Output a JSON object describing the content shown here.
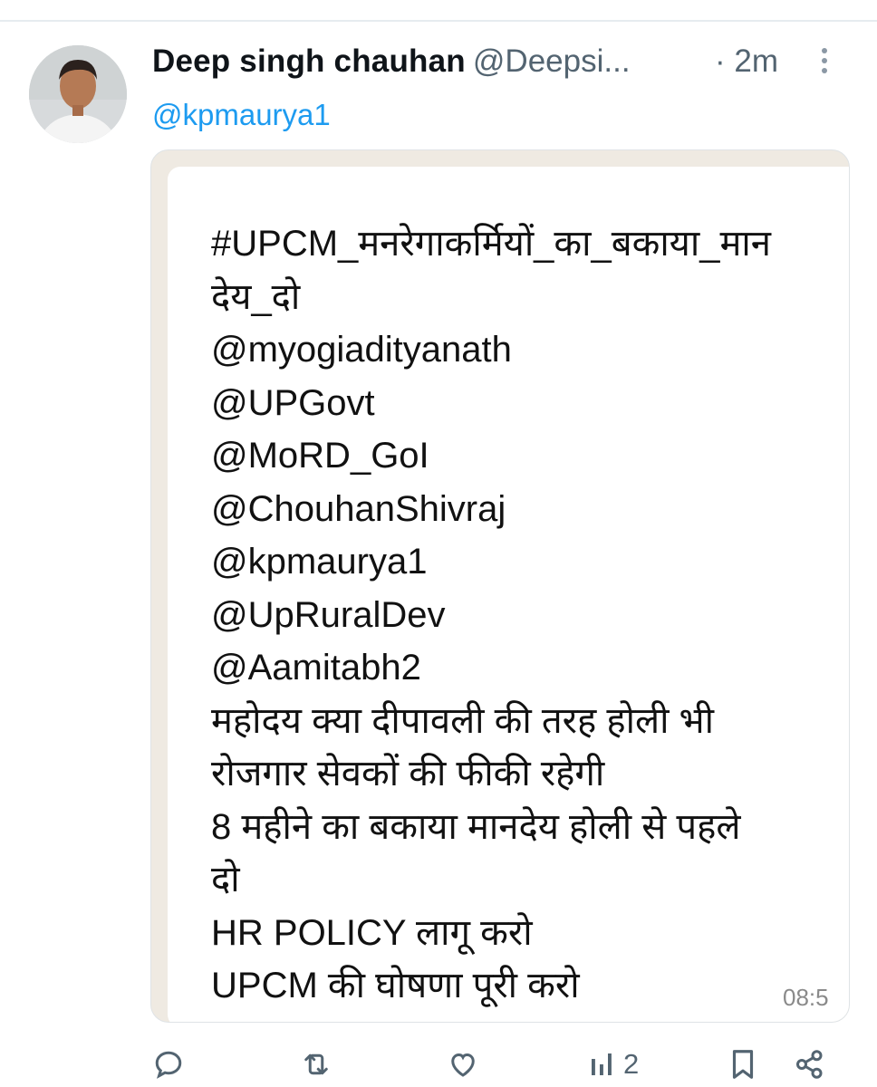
{
  "tweet": {
    "display_name": "Deep singh chauhan",
    "handle": "@Deepsi...",
    "time": "· 2m",
    "reply_to": "@kpmaurya1"
  },
  "media": {
    "message_lines": [
      "#UPCM_मनरेगाकर्मियों_का_बकाया_मान",
      "देय_दो",
      "@myogiadityanath",
      "@UPGovt",
      "@MoRD_GoI",
      "@ChouhanShivraj",
      "@kpmaurya1",
      "@UpRuralDev",
      "@Aamitabh2",
      "महोदय क्या दीपावली की तरह होली भी",
      "रोजगार सेवकों की फीकी रहेगी",
      "8 महीने का बकाया मानदेय होली से पहले",
      "दो",
      "HR POLICY लागू करो",
      "UPCM की घोषणा पूरी करो"
    ],
    "timestamp_partial": "08:5"
  },
  "actions": {
    "views_count": "2",
    "icons": [
      "reply-icon",
      "retweet-icon",
      "like-icon",
      "views-icon",
      "bookmark-icon",
      "share-icon"
    ]
  },
  "colors": {
    "link": "#1d9bf0",
    "secondary_text": "#536471",
    "primary_text": "#0f1419"
  }
}
